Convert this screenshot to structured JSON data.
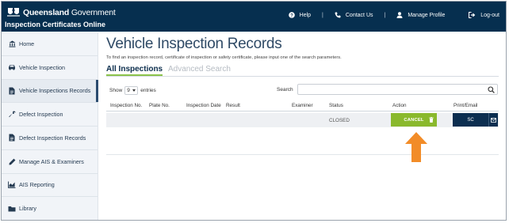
{
  "header": {
    "gov_name_bold": "Queensland",
    "gov_name_rest": " Government",
    "app_name": "Inspection Certificates Online",
    "nav": [
      {
        "label": "Help",
        "icon": "question-circle-icon"
      },
      {
        "label": "Contact Us",
        "icon": "phone-icon"
      },
      {
        "label": "Manage Profile",
        "icon": "user-icon"
      },
      {
        "label": "Log-out",
        "icon": "sign-out-icon"
      }
    ],
    "separator": "|",
    "colors": {
      "bar": "#062f4f",
      "text": "#ffffff"
    }
  },
  "sidebar": {
    "items": [
      {
        "label": "Home",
        "icon": "bank-icon",
        "active": false
      },
      {
        "label": "Vehicle Inspection",
        "icon": "car-icon",
        "active": false
      },
      {
        "label": "Vehicle Inspections Records",
        "icon": "file-icon",
        "active": true
      },
      {
        "label": "Defect Inspection",
        "icon": "wrench-icon",
        "active": false
      },
      {
        "label": "Defect Inspection Records",
        "icon": "file-icon",
        "active": false
      },
      {
        "label": "Manage AIS & Examiners",
        "icon": "pencil-icon",
        "active": false
      },
      {
        "label": "AIS Reporting",
        "icon": "chart-icon",
        "active": false
      },
      {
        "label": "Library",
        "icon": "folder-icon",
        "active": false
      }
    ]
  },
  "main": {
    "title": "Vehicle Inspection Records",
    "hint": "To find an inspection record, certificate of inspection or safety certificate, please input one of the search parameters.",
    "tabs": [
      {
        "label": "All Inspections",
        "active": true
      },
      {
        "label": "Advanced Search",
        "active": false
      }
    ],
    "show_label": "Show",
    "entries_value": "9",
    "entries_label": "entries",
    "search_label": "Search",
    "search_value": "",
    "columns": [
      "Inspection No.",
      "Plate No.",
      "Inspection Date",
      "Result",
      "Examiner",
      "Status",
      "Action",
      "Print/Email"
    ],
    "rows": [
      {
        "inspection_no": "",
        "plate_no": "",
        "inspection_date": "",
        "result": "",
        "examiner": "",
        "status": "CLOSED",
        "action_label": "CANCEL",
        "print_label": "SC"
      }
    ]
  },
  "annotation": {
    "arrow_color": "#f28c28",
    "points_to": "cancel-button"
  },
  "colors": {
    "accent_green": "#8ab92d",
    "navy": "#0c2e50",
    "title": "#2f4a66"
  }
}
